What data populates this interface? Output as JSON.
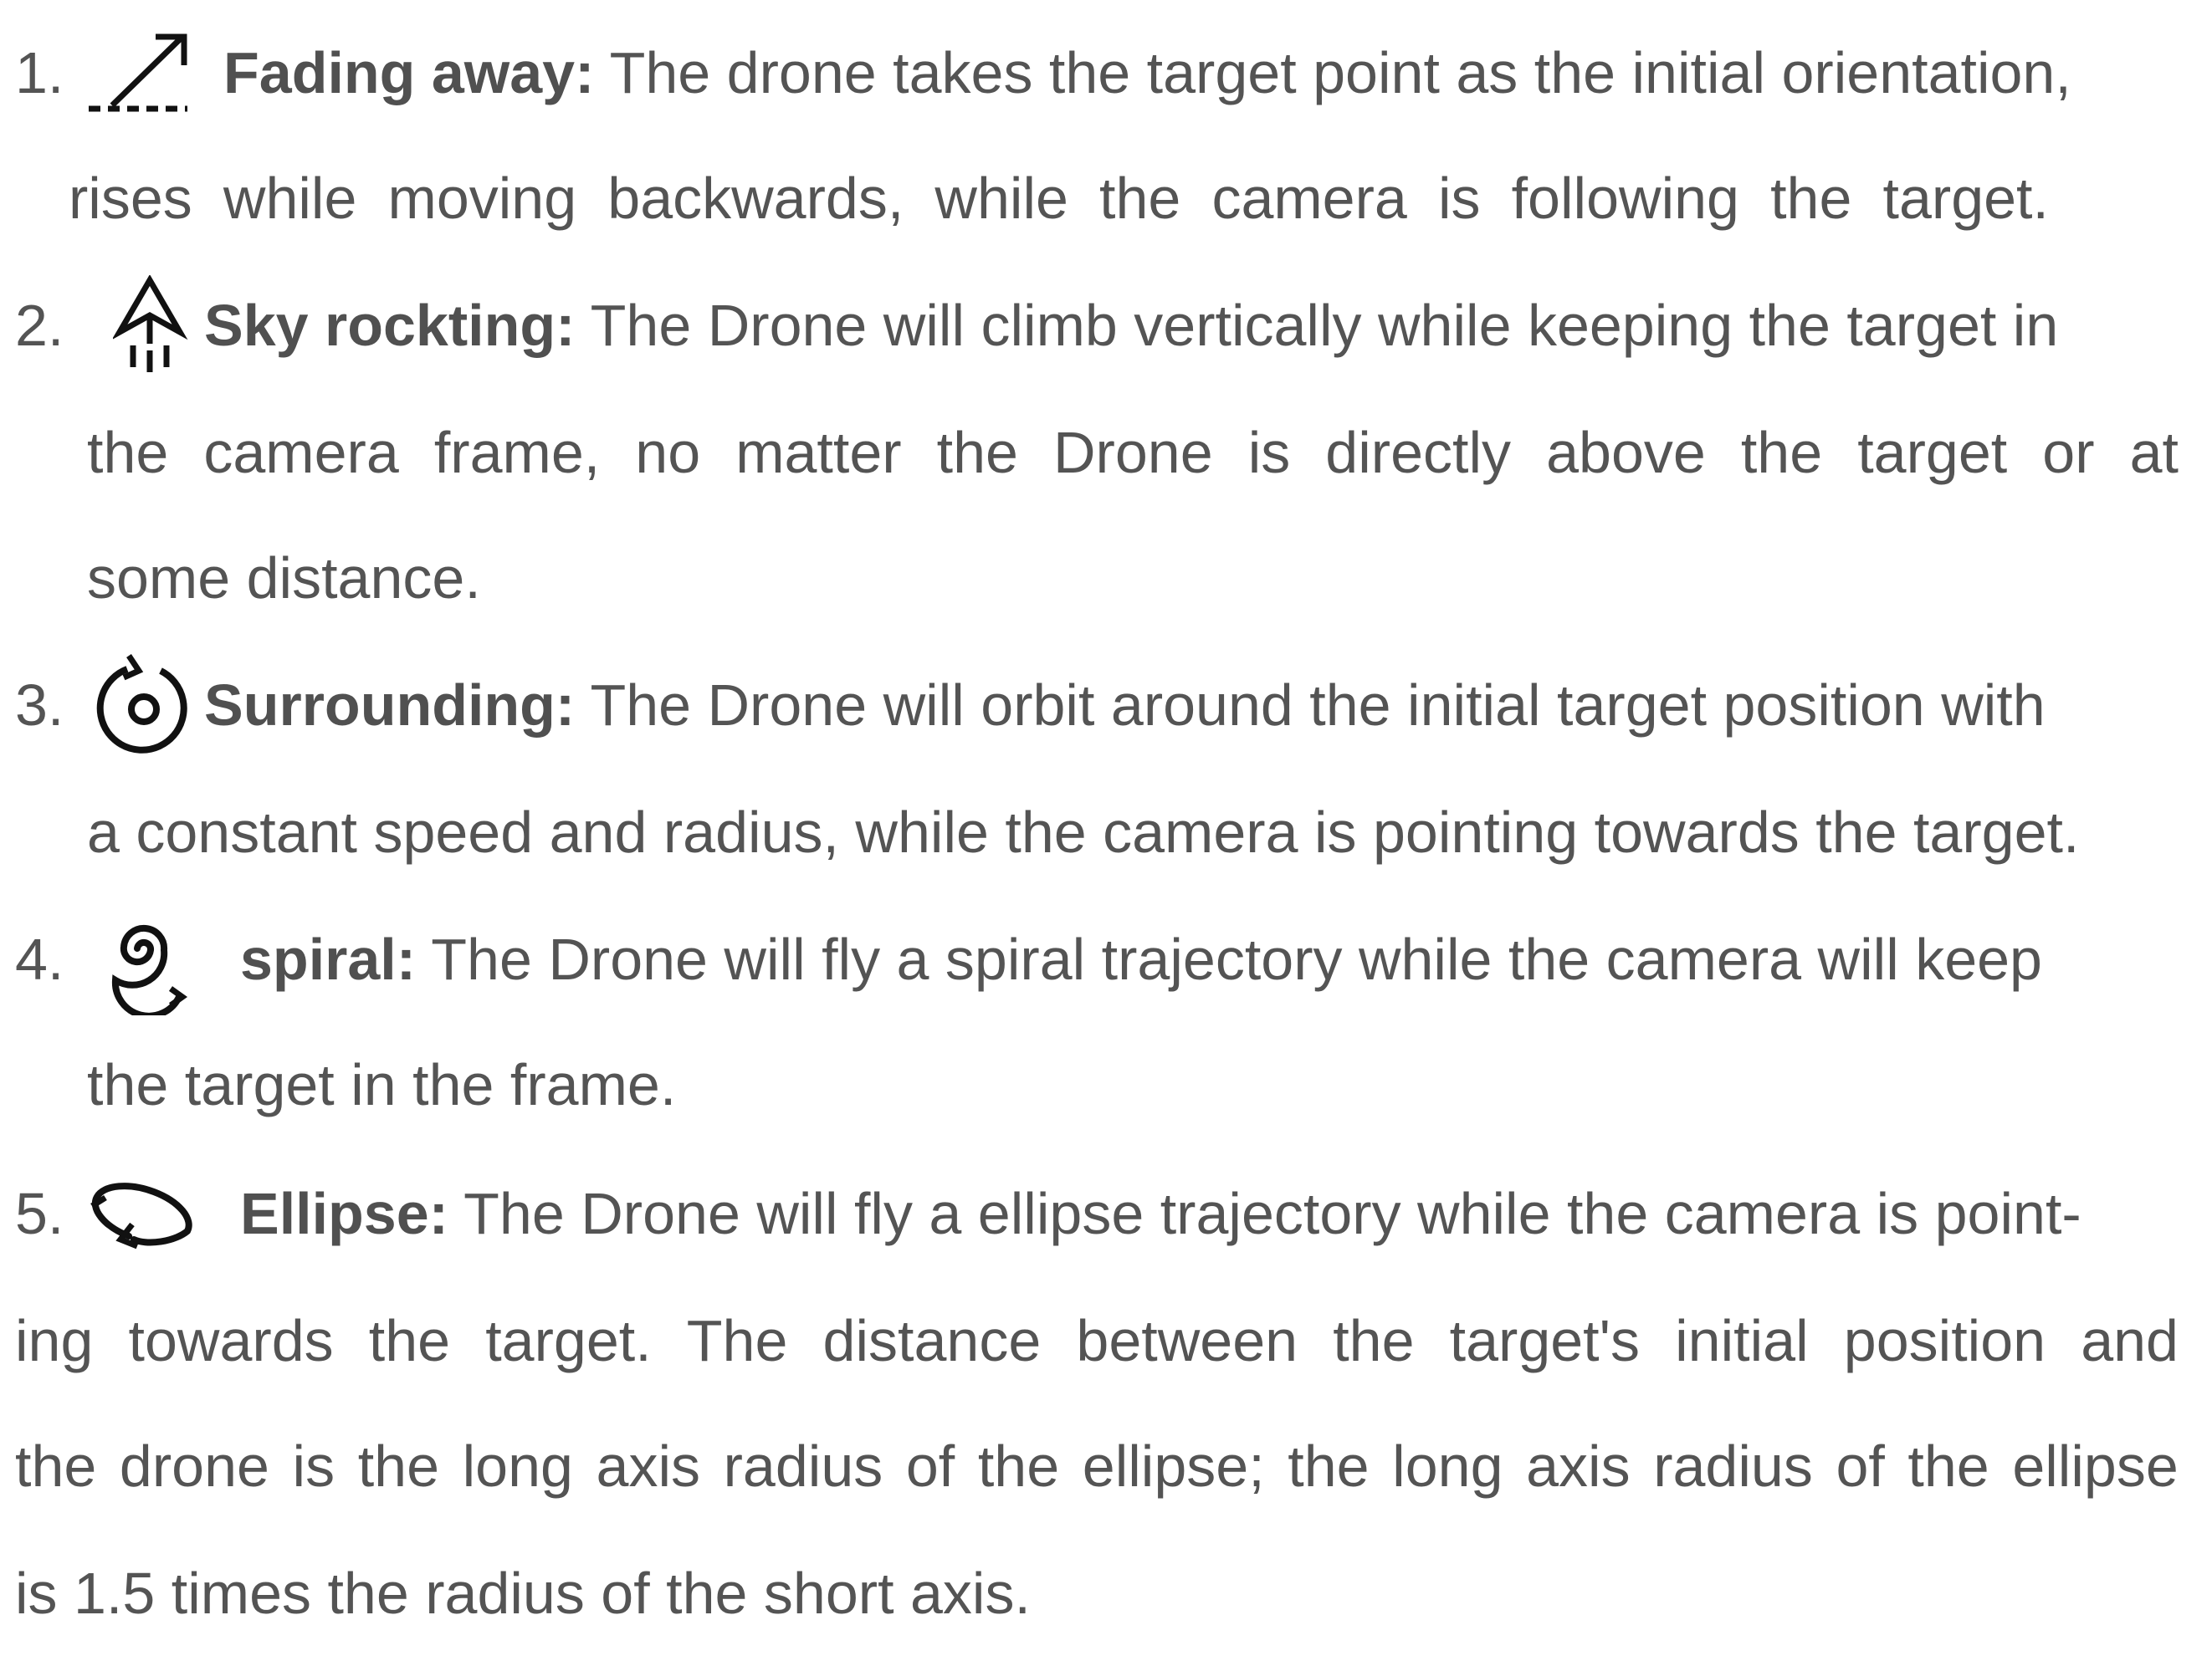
{
  "items": [
    {
      "number": "1.",
      "icon": "fading-away-icon",
      "title": "Fading away:",
      "text_line1": "The drone takes the target point as the initial orientation,",
      "text_cont": [
        "rises while moving backwards, while the camera is following the target."
      ]
    },
    {
      "number": "2.",
      "icon": "sky-rocket-icon",
      "title": "Sky rockting:",
      "text_line1": "The Drone will climb vertically while keeping the target in",
      "text_cont": [
        "the camera frame, no matter the Drone is directly above the target or at",
        "some distance."
      ]
    },
    {
      "number": "3.",
      "icon": "orbit-icon",
      "title": "Surrounding:",
      "text_line1": "The Drone will orbit around the initial target position with",
      "text_cont": [
        "a constant speed and radius, while the camera is pointing towards the target."
      ]
    },
    {
      "number": "4.",
      "icon": "spiral-icon",
      "title": "spiral:",
      "text_line1": "The Drone will fly a spiral trajectory while the camera will keep",
      "text_cont": [
        "the target in the frame."
      ]
    },
    {
      "number": "5.",
      "icon": "ellipse-icon",
      "title": "Ellipse:",
      "text_line1": "The Drone will fly a ellipse trajectory while the camera is point-",
      "text_cont": [
        "ing towards the target. The distance between the target's initial position and",
        "the drone is the long axis radius of the ellipse; the long axis radius of the ellipse",
        "is 1.5 times the radius of the short axis."
      ]
    }
  ]
}
